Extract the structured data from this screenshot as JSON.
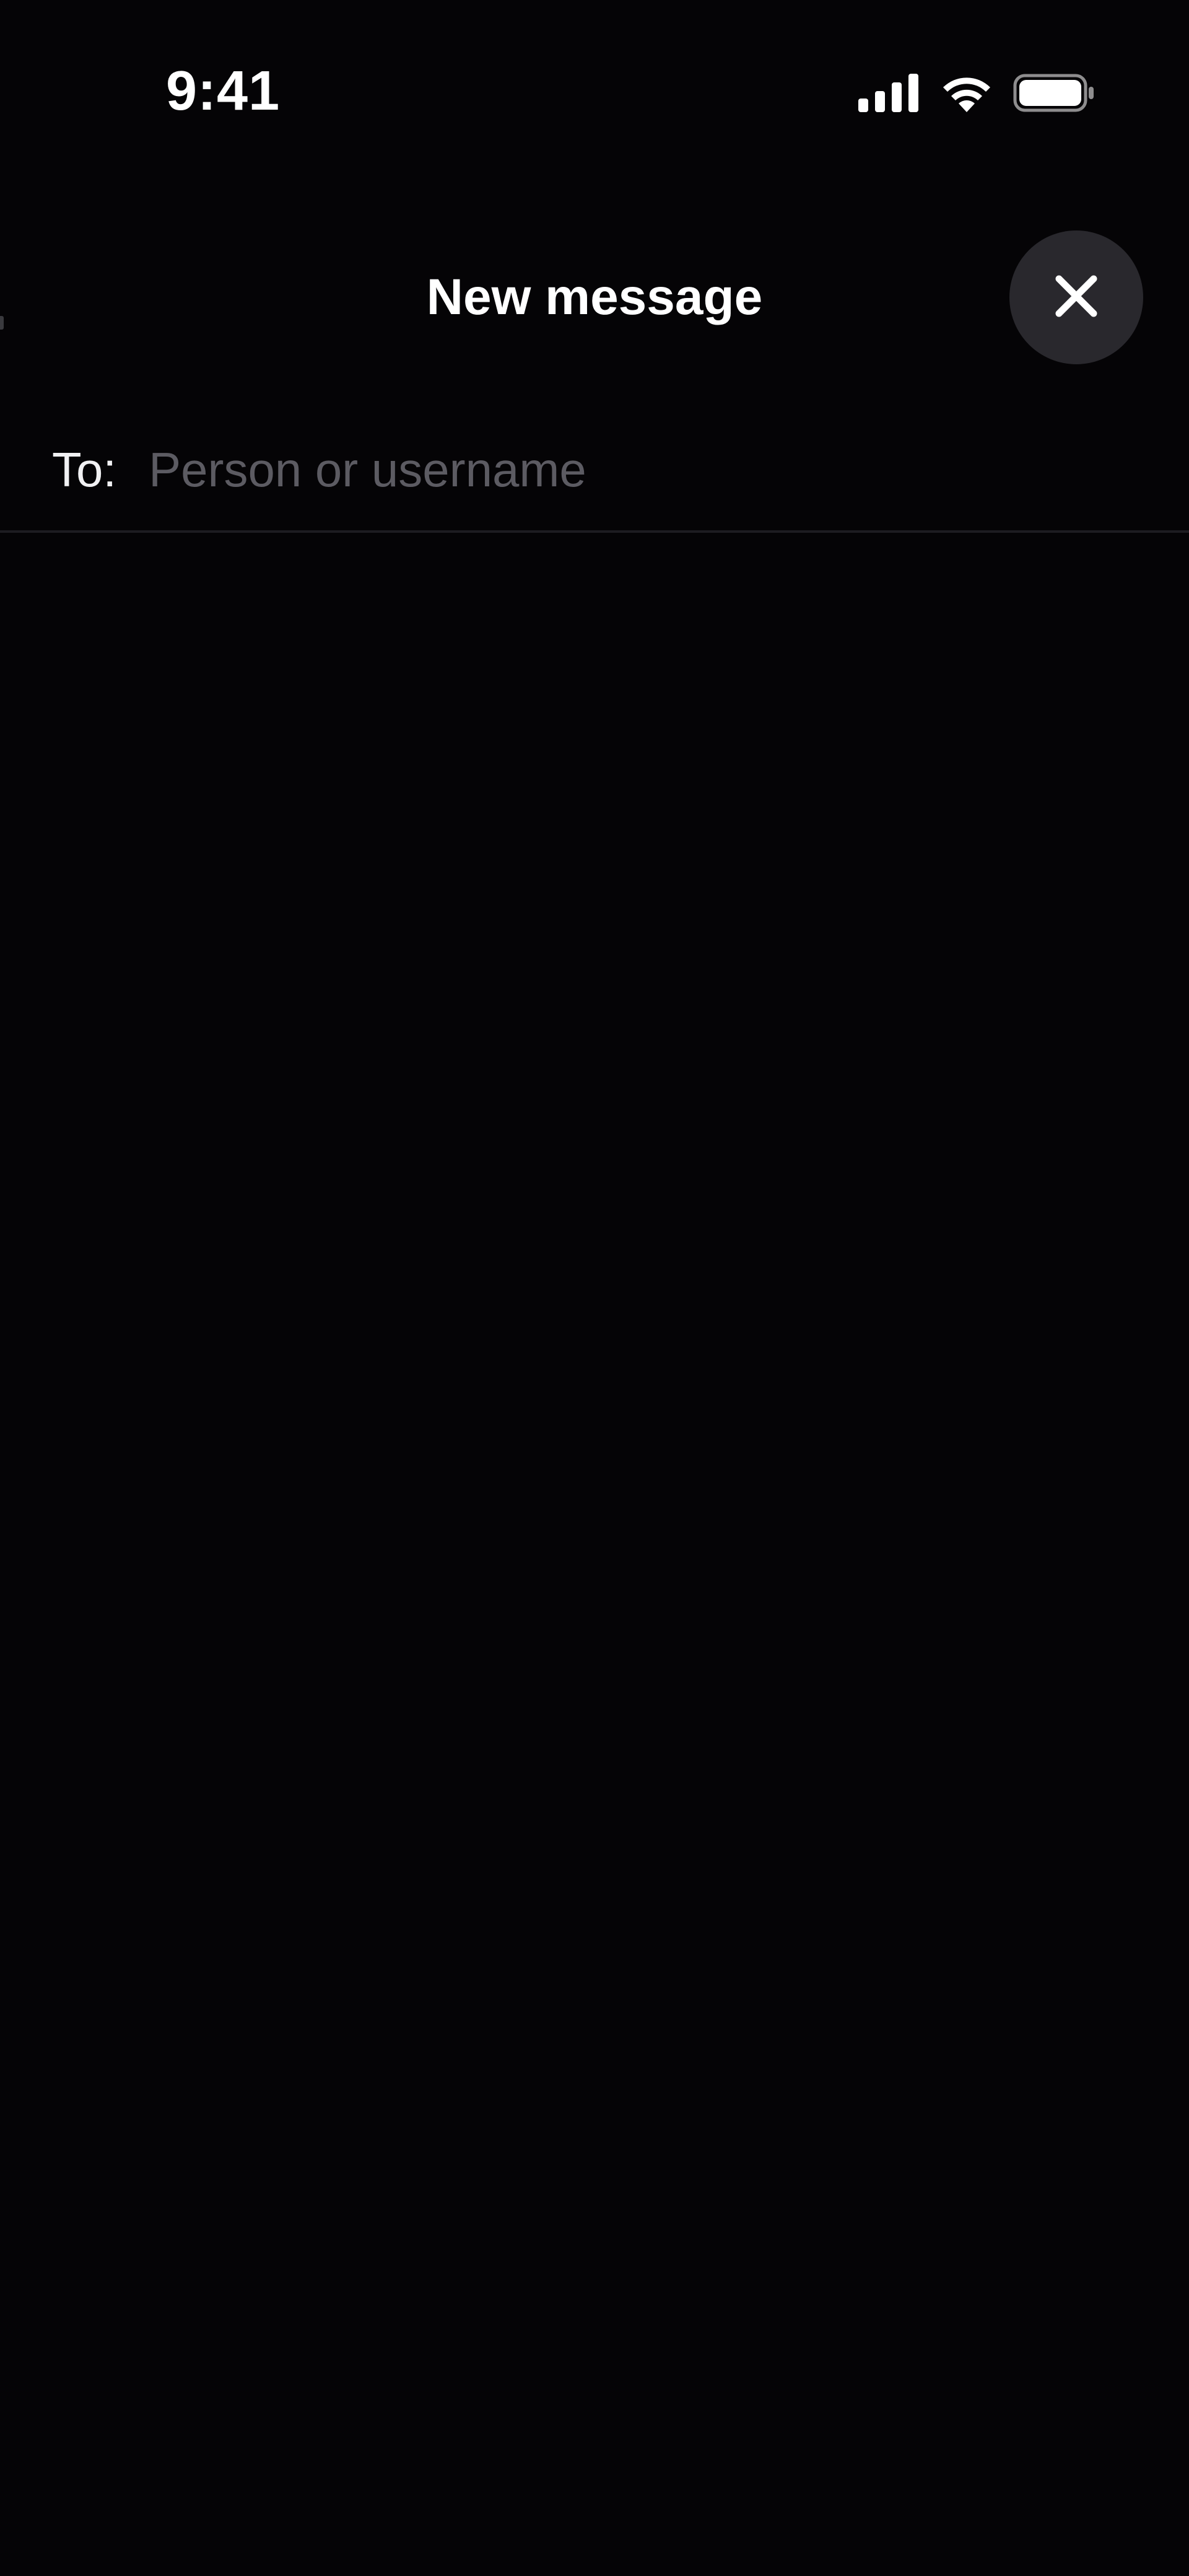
{
  "status_bar": {
    "time": "9:41",
    "icons": [
      "cellular-signal-icon",
      "wifi-icon",
      "battery-icon"
    ]
  },
  "header": {
    "title": "New message",
    "close_icon": "close-icon"
  },
  "recipient": {
    "label": "To:",
    "value": "",
    "placeholder": "Person or username"
  },
  "colors": {
    "background": "#050406",
    "close_button_bg": "#29282d",
    "placeholder": "#5c5b62",
    "divider": "#1d1c21",
    "text": "#ffffff"
  }
}
